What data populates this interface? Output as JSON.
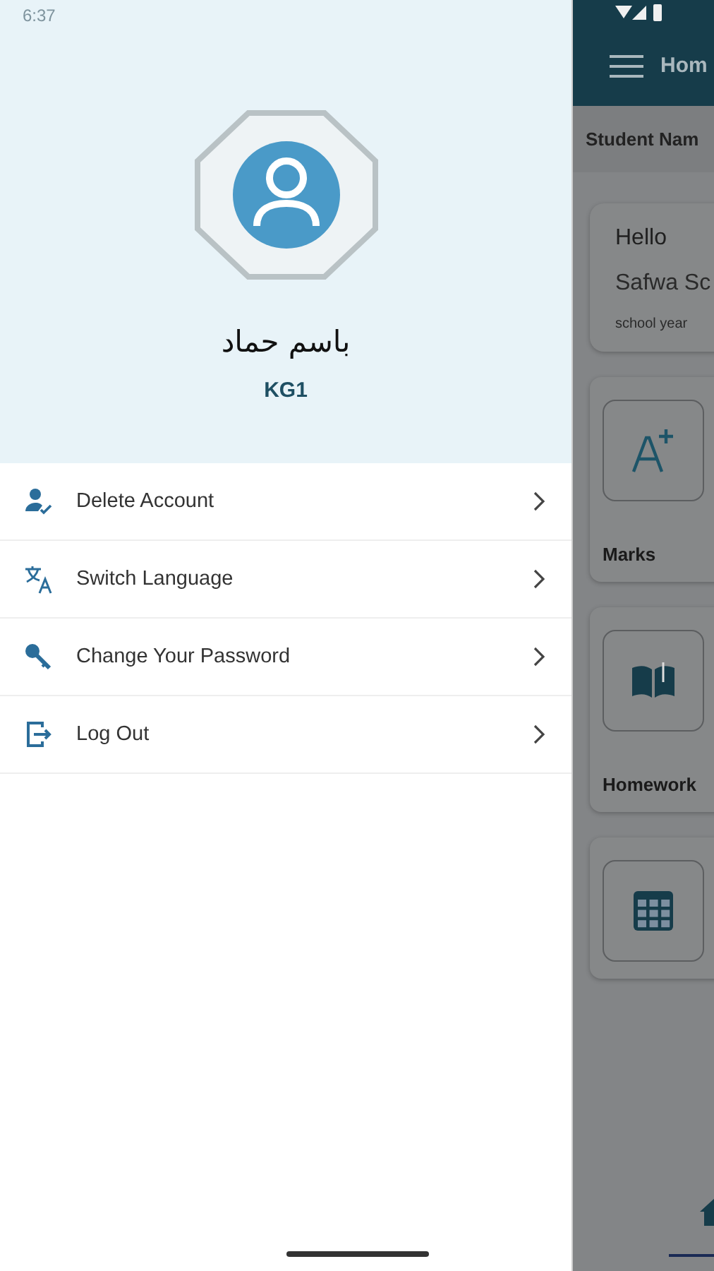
{
  "status_bar": {
    "time": "6:37"
  },
  "drawer": {
    "profile": {
      "name": "باسم حماد",
      "grade": "KG1"
    },
    "menu": [
      {
        "kind": "delete-account",
        "label": "Delete Account"
      },
      {
        "kind": "language",
        "label": "Switch Language"
      },
      {
        "kind": "password",
        "label": "Change Your Password"
      },
      {
        "kind": "logout",
        "label": "Log Out"
      }
    ]
  },
  "background_screen": {
    "toolbar_title": "Hom",
    "student_bar": "Student Nam",
    "greeting": "Hello",
    "school": "Safwa Sc",
    "school_year": "school year",
    "tiles": [
      {
        "kind": "marks",
        "label": "Marks"
      },
      {
        "kind": "homework",
        "label": "Homework"
      },
      {
        "kind": "timetable"
      }
    ]
  }
}
